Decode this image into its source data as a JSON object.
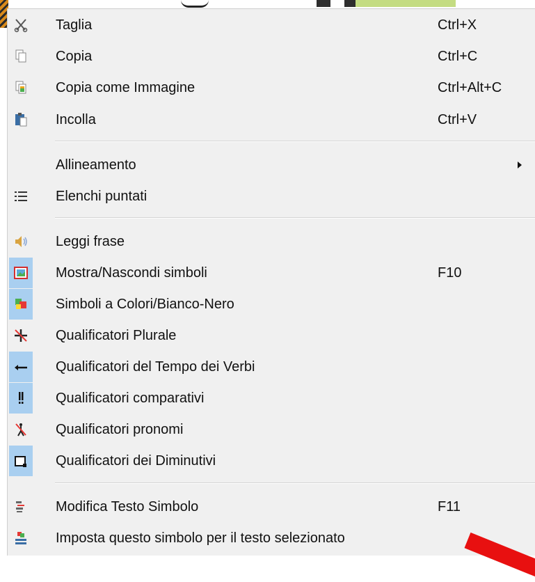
{
  "menu": {
    "items": [
      {
        "label": "Taglia",
        "shortcut": "Ctrl+X",
        "icon": "scissors-icon"
      },
      {
        "label": "Copia",
        "shortcut": "Ctrl+C",
        "icon": "copy-icon"
      },
      {
        "label": "Copia come Immagine",
        "shortcut": "Ctrl+Alt+C",
        "icon": "copy-image-icon"
      },
      {
        "label": "Incolla",
        "shortcut": "Ctrl+V",
        "icon": "paste-icon"
      },
      {
        "label": "Allineamento",
        "shortcut": "",
        "icon": "",
        "submenu": true
      },
      {
        "label": "Elenchi puntati",
        "shortcut": "",
        "icon": "bullet-list-icon"
      },
      {
        "label": "Leggi frase",
        "shortcut": "",
        "icon": "speaker-icon"
      },
      {
        "label": "Mostra/Nascondi simboli",
        "shortcut": "F10",
        "icon": "picture-icon",
        "checked": true
      },
      {
        "label": "Simboli a Colori/Bianco-Nero",
        "shortcut": "",
        "icon": "color-symbols-icon",
        "checked": true
      },
      {
        "label": "Qualificatori Plurale",
        "shortcut": "",
        "icon": "plural-qualifier-icon"
      },
      {
        "label": "Qualificatori del Tempo dei Verbi",
        "shortcut": "",
        "icon": "verb-tense-icon",
        "checked": true
      },
      {
        "label": "Qualificatori comparativi",
        "shortcut": "",
        "icon": "comparative-icon",
        "checked": true
      },
      {
        "label": "Qualificatori pronomi",
        "shortcut": "",
        "icon": "pronoun-icon"
      },
      {
        "label": "Qualificatori dei Diminutivi",
        "shortcut": "",
        "icon": "diminutive-icon",
        "checked": true
      },
      {
        "label": "Modifica Testo Simbolo",
        "shortcut": "F11",
        "icon": "edit-symbol-text-icon"
      },
      {
        "label": "Imposta questo simbolo per il testo selezionato",
        "shortcut": "",
        "icon": "set-symbol-icon"
      }
    ]
  },
  "colors": {
    "menu_bg": "#f0f0f0",
    "checked_bg": "#a9cff0",
    "annotation_arrow": "#e81010"
  }
}
